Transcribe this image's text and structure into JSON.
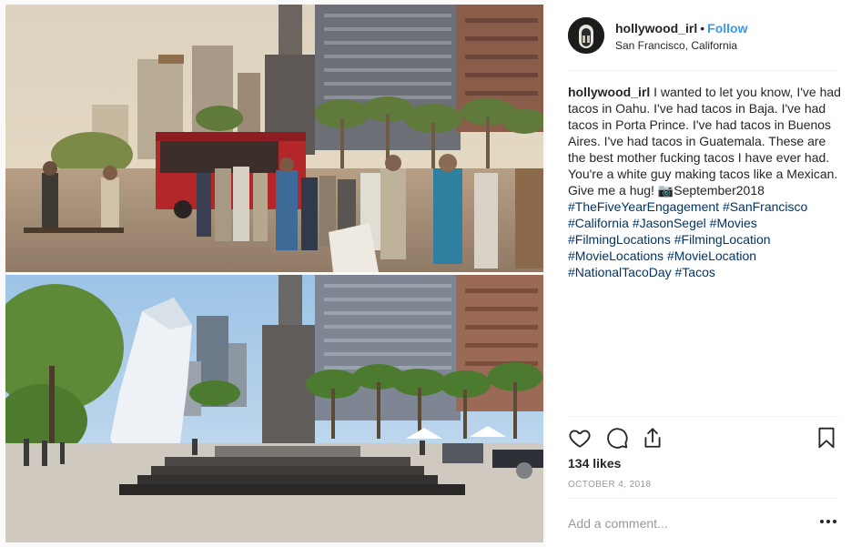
{
  "post": {
    "username": "hollywood_irl",
    "separator": "•",
    "follow_label": "Follow",
    "location": "San Francisco, California",
    "caption": {
      "username": "hollywood_irl",
      "text": " I wanted to let you know, I've had tacos in Oahu. I've had tacos in Baja. I've had tacos in Porta Prince. I've had tacos in Buenos Aires. I've had tacos in Guatemala. These are the best mother fucking tacos I have ever had. You're a white guy making tacos like a Mexican. Give me a hug! 📷September2018",
      "hashtags": [
        "#TheFiveYearEngagement",
        "#SanFrancisco",
        "#California",
        "#JasonSegel",
        "#Movies",
        "#FilmingLocations",
        "#FilmingLocation",
        "#MovieLocations",
        "#MovieLocation",
        "#NationalTacoDay",
        "#Tacos"
      ]
    },
    "likes": "134 likes",
    "date": "OCTOBER 4, 2018",
    "comment_placeholder": "Add a comment..."
  },
  "icons": {
    "like": "heart-icon",
    "comment": "comment-icon",
    "share": "share-icon",
    "save": "bookmark-icon",
    "more": "more-options-icon"
  },
  "colors": {
    "follow": "#3897f0",
    "hashtag": "#003569",
    "muted": "#999999",
    "divider": "#efefef"
  }
}
